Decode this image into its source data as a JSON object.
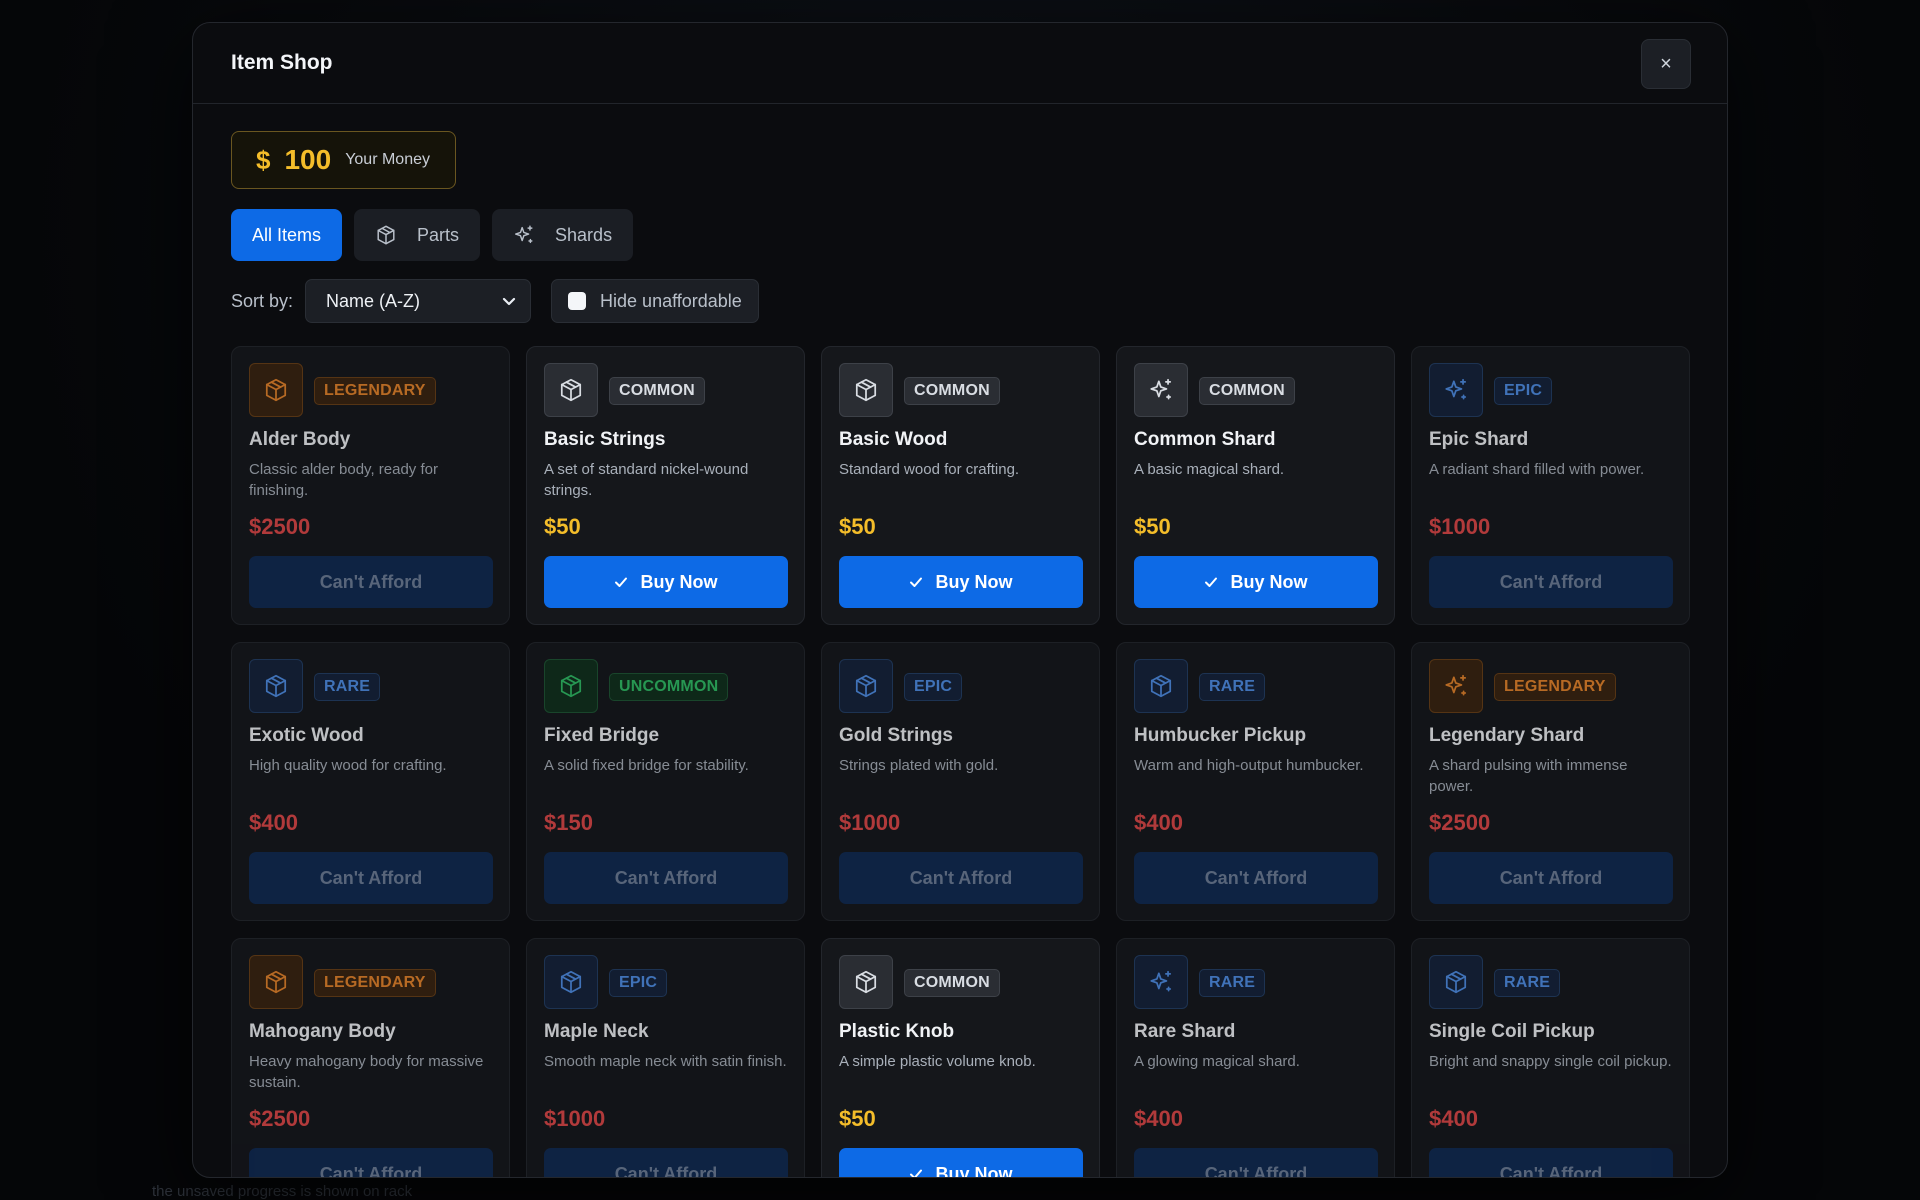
{
  "page_background_hint": "the unsaved progress is shown on rack",
  "modal": {
    "title": "Item Shop",
    "close_label": "×"
  },
  "money": {
    "symbol": "$",
    "amount": "100",
    "label": "Your Money"
  },
  "tabs": [
    {
      "label": "All Items",
      "icon": "",
      "active": true
    },
    {
      "label": "Parts",
      "icon": "cube-icon",
      "active": false
    },
    {
      "label": "Shards",
      "icon": "sparkle-icon",
      "active": false
    }
  ],
  "sort": {
    "label": "Sort by:",
    "value": "Name (A-Z)"
  },
  "filter": {
    "hide_unaffordable_label": "Hide unaffordable",
    "checked": false
  },
  "buttons": {
    "buy": "Buy Now",
    "cant": "Can't Afford"
  },
  "rarity_colors": {
    "LEGENDARY": {
      "text": "#e8852a",
      "bg": "#3a2410",
      "border": "#6a4016",
      "icon": "#e8852a"
    },
    "COMMON": {
      "text": "#d9dde3",
      "bg": "#2a2d33",
      "border": "#3d4148",
      "icon": "#d9dde3"
    },
    "EPIC": {
      "text": "#4f8fe8",
      "bg": "#14233b",
      "border": "#233e66",
      "icon": "#4f8fe8"
    },
    "RARE": {
      "text": "#4f8fe8",
      "bg": "#14233b",
      "border": "#233e66",
      "icon": "#4f8fe8"
    },
    "UNCOMMON": {
      "text": "#2fbe66",
      "bg": "#10301d",
      "border": "#1d5633",
      "icon": "#2fbe66"
    }
  },
  "price_colors": {
    "affordable": "#f4bd2a",
    "unaffordable": "#e04848"
  },
  "items": [
    {
      "name": "Alder Body",
      "rarity": "LEGENDARY",
      "icon": "cube-icon",
      "desc": "Classic alder body, ready for finishing.",
      "price": "$2500",
      "affordable": false
    },
    {
      "name": "Basic Strings",
      "rarity": "COMMON",
      "icon": "cube-icon",
      "desc": "A set of standard nickel-wound strings.",
      "price": "$50",
      "affordable": true
    },
    {
      "name": "Basic Wood",
      "rarity": "COMMON",
      "icon": "cube-icon",
      "desc": "Standard wood for crafting.",
      "price": "$50",
      "affordable": true
    },
    {
      "name": "Common Shard",
      "rarity": "COMMON",
      "icon": "sparkle-icon",
      "desc": "A basic magical shard.",
      "price": "$50",
      "affordable": true
    },
    {
      "name": "Epic Shard",
      "rarity": "EPIC",
      "icon": "sparkle-icon",
      "desc": "A radiant shard filled with power.",
      "price": "$1000",
      "affordable": false
    },
    {
      "name": "Exotic Wood",
      "rarity": "RARE",
      "icon": "cube-icon",
      "desc": "High quality wood for crafting.",
      "price": "$400",
      "affordable": false
    },
    {
      "name": "Fixed Bridge",
      "rarity": "UNCOMMON",
      "icon": "cube-icon",
      "desc": "A solid fixed bridge for stability.",
      "price": "$150",
      "affordable": false
    },
    {
      "name": "Gold Strings",
      "rarity": "EPIC",
      "icon": "cube-icon",
      "desc": "Strings plated with gold.",
      "price": "$1000",
      "affordable": false
    },
    {
      "name": "Humbucker Pickup",
      "rarity": "RARE",
      "icon": "cube-icon",
      "desc": "Warm and high-output humbucker.",
      "price": "$400",
      "affordable": false
    },
    {
      "name": "Legendary Shard",
      "rarity": "LEGENDARY",
      "icon": "sparkle-icon",
      "desc": "A shard pulsing with immense power.",
      "price": "$2500",
      "affordable": false
    },
    {
      "name": "Mahogany Body",
      "rarity": "LEGENDARY",
      "icon": "cube-icon",
      "desc": "Heavy mahogany body for massive sustain.",
      "price": "$2500",
      "affordable": false
    },
    {
      "name": "Maple Neck",
      "rarity": "EPIC",
      "icon": "cube-icon",
      "desc": "Smooth maple neck with satin finish.",
      "price": "$1000",
      "affordable": false
    },
    {
      "name": "Plastic Knob",
      "rarity": "COMMON",
      "icon": "cube-icon",
      "desc": "A simple plastic volume knob.",
      "price": "$50",
      "affordable": true
    },
    {
      "name": "Rare Shard",
      "rarity": "RARE",
      "icon": "sparkle-icon",
      "desc": "A glowing magical shard.",
      "price": "$400",
      "affordable": false
    },
    {
      "name": "Single Coil Pickup",
      "rarity": "RARE",
      "icon": "cube-icon",
      "desc": "Bright and snappy single coil pickup.",
      "price": "$400",
      "affordable": false
    }
  ]
}
